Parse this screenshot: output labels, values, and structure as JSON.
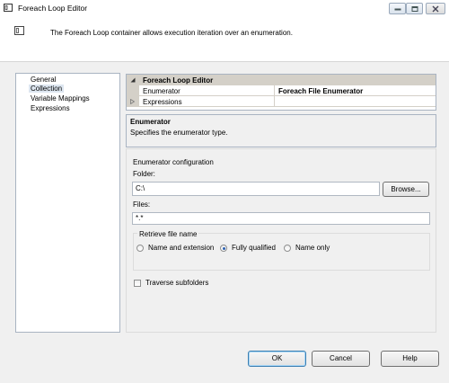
{
  "window": {
    "title": "Foreach Loop Editor",
    "header_text": "The Foreach Loop container allows execution iteration over an enumeration."
  },
  "nav": {
    "items": [
      {
        "label": "General"
      },
      {
        "label": "Collection"
      },
      {
        "label": "Variable Mappings"
      },
      {
        "label": "Expressions"
      }
    ],
    "selected": "Collection"
  },
  "grid": {
    "category": "Foreach Loop Editor",
    "rows": [
      {
        "name": "Enumerator",
        "value": "Foreach File Enumerator"
      },
      {
        "name": "Expressions",
        "value": ""
      }
    ]
  },
  "description": {
    "title": "Enumerator",
    "text": "Specifies the enumerator type."
  },
  "config": {
    "group_label": "Enumerator configuration",
    "folder_label": "Folder:",
    "folder_value": "C:\\",
    "browse_label": "Browse...",
    "files_label": "Files:",
    "files_value": "*.*",
    "retrieve_label": "Retrieve file name",
    "options": [
      {
        "label": "Name and extension",
        "checked": false
      },
      {
        "label": "Fully qualified",
        "checked": true
      },
      {
        "label": "Name only",
        "checked": false
      }
    ],
    "traverse_label": "Traverse subfolders",
    "traverse_checked": false
  },
  "buttons": {
    "ok": "OK",
    "cancel": "Cancel",
    "help": "Help"
  },
  "colors": {
    "selected_bg": "#dde6f0",
    "category_bg": "#d4d0c8",
    "accent": "#2a5fb0"
  },
  "icons": [
    "app-icon",
    "minimize-icon",
    "maximize-icon",
    "close-icon",
    "header-icon",
    "collapse-triangle-icon",
    "expand-triangle-icon"
  ]
}
